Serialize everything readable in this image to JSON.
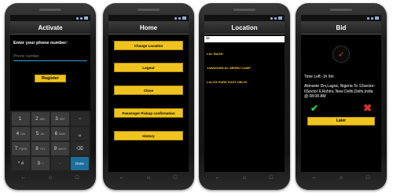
{
  "status_icons": [
    "wifi-icon",
    "signal-icon",
    "battery-icon"
  ],
  "activate": {
    "title": "Activate",
    "phone_label": "Enter your phone number:",
    "phone_placeholder": "Phone number",
    "register_label": "Register",
    "keys": [
      {
        "main": "1",
        "sub": ""
      },
      {
        "main": "2",
        "sub": "ABC"
      },
      {
        "main": "3",
        "sub": "DEF"
      },
      {
        "main": "−",
        "sub": ""
      },
      {
        "main": "4",
        "sub": "GHI"
      },
      {
        "main": "5",
        "sub": "JKL"
      },
      {
        "main": "6",
        "sub": "MNO"
      },
      {
        "main": "␣",
        "sub": ""
      },
      {
        "main": "7",
        "sub": "PQRS"
      },
      {
        "main": "8",
        "sub": "TUV"
      },
      {
        "main": "9",
        "sub": "WXYZ"
      },
      {
        "main": "⌫",
        "sub": ""
      },
      {
        "main": "* #",
        "sub": ""
      },
      {
        "main": "0",
        "sub": "+"
      },
      {
        "main": "·",
        "sub": ""
      },
      {
        "main": "Done",
        "sub": ""
      }
    ]
  },
  "home": {
    "title": "Home",
    "buttons": [
      "Change Location",
      "Logout",
      "Close",
      "Passenger Pickup confirmation",
      "History"
    ]
  },
  "location": {
    "title": "Location",
    "search_value": "lal",
    "results": [
      "LAL BAGH",
      "JAWAHARLAL NEHRU CAMP",
      "LALITA PARK EAST DELHI"
    ]
  },
  "bid": {
    "title": "Bid",
    "time_left": "Time Left:-1h 0m",
    "address": "Akinsete Drv,Lagos, Nigeria To 12sector-6Sector 6,Rohini, New Delhi,Delhi,India",
    "pickup_time": "@ 08:08 AM",
    "later_label": "Later",
    "colors": {
      "accent": "#f0c420",
      "accept": "#2ecc40",
      "reject": "#e0302a"
    }
  },
  "nav_icons": [
    "back-icon",
    "home-icon",
    "recent-apps-icon"
  ]
}
